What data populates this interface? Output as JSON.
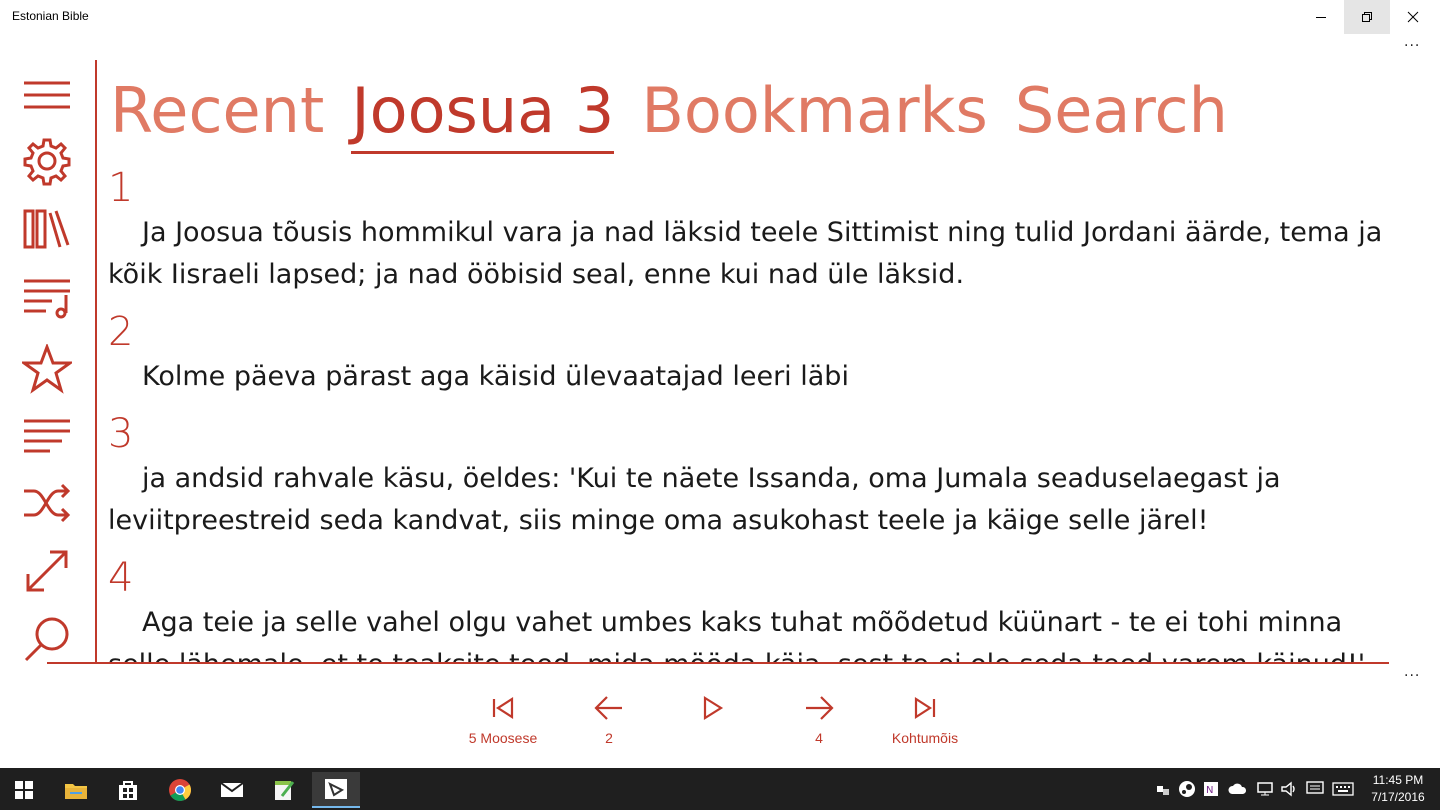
{
  "window": {
    "title": "Estonian Bible",
    "more_label": "..."
  },
  "sidebar": {
    "items": [
      {
        "icon": "hamburger-menu-icon"
      },
      {
        "icon": "gear-icon"
      },
      {
        "icon": "library-books-icon"
      },
      {
        "icon": "playlist-music-icon"
      },
      {
        "icon": "star-icon"
      },
      {
        "icon": "text-lines-icon"
      },
      {
        "icon": "shuffle-icon"
      },
      {
        "icon": "resize-diagonal-icon"
      },
      {
        "icon": "search-icon"
      }
    ]
  },
  "tabs": [
    {
      "label": "Recent",
      "active": false
    },
    {
      "label": "Joosua 3",
      "active": true
    },
    {
      "label": "Bookmarks",
      "active": false
    },
    {
      "label": "Search",
      "active": false
    }
  ],
  "verses": [
    {
      "number": "1",
      "text": "Ja Joosua tõusis hommikul vara ja nad läksid teele Sittimist ning tulid Jordani äärde, tema ja kõik Iisraeli lapsed; ja nad ööbisid seal, enne kui nad üle läksid."
    },
    {
      "number": "2",
      "text": "Kolme päeva pärast aga käisid ülevaatajad leeri läbi"
    },
    {
      "number": "3",
      "text": "ja andsid rahvale käsu, öeldes: 'Kui te näete Issanda, oma Jumala seaduselaegast ja leviitpreestreid seda kandvat, siis minge oma asukohast teele ja käige selle järel!"
    },
    {
      "number": "4",
      "text": "Aga teie ja selle vahel olgu vahet umbes kaks tuhat mõõdetud küünart - te ei tohi minna selle lähemale, et te teaksite teed, mida mööda käia, sest te ei ole seda teed varem käinud!'"
    }
  ],
  "bottom_more_label": "...",
  "nav": {
    "first": {
      "label": "5 Moosese",
      "icon": "skip-to-start-icon"
    },
    "prev": {
      "label": "2",
      "icon": "arrow-left-icon"
    },
    "play": {
      "label": "",
      "icon": "play-icon"
    },
    "next": {
      "label": "4",
      "icon": "arrow-right-icon"
    },
    "last": {
      "label": "Kohtumõis",
      "icon": "skip-to-end-icon"
    }
  },
  "taskbar": {
    "apps": [
      "windows-start-icon",
      "file-explorer-icon",
      "store-icon",
      "chrome-icon",
      "mail-icon",
      "notepad-icon",
      "bible-app-icon"
    ],
    "time": "11:45 PM",
    "date": "7/17/2016"
  },
  "colors": {
    "accent": "#c0392b",
    "accent_light": "#e07a64",
    "taskbar": "#1f1f1f"
  }
}
